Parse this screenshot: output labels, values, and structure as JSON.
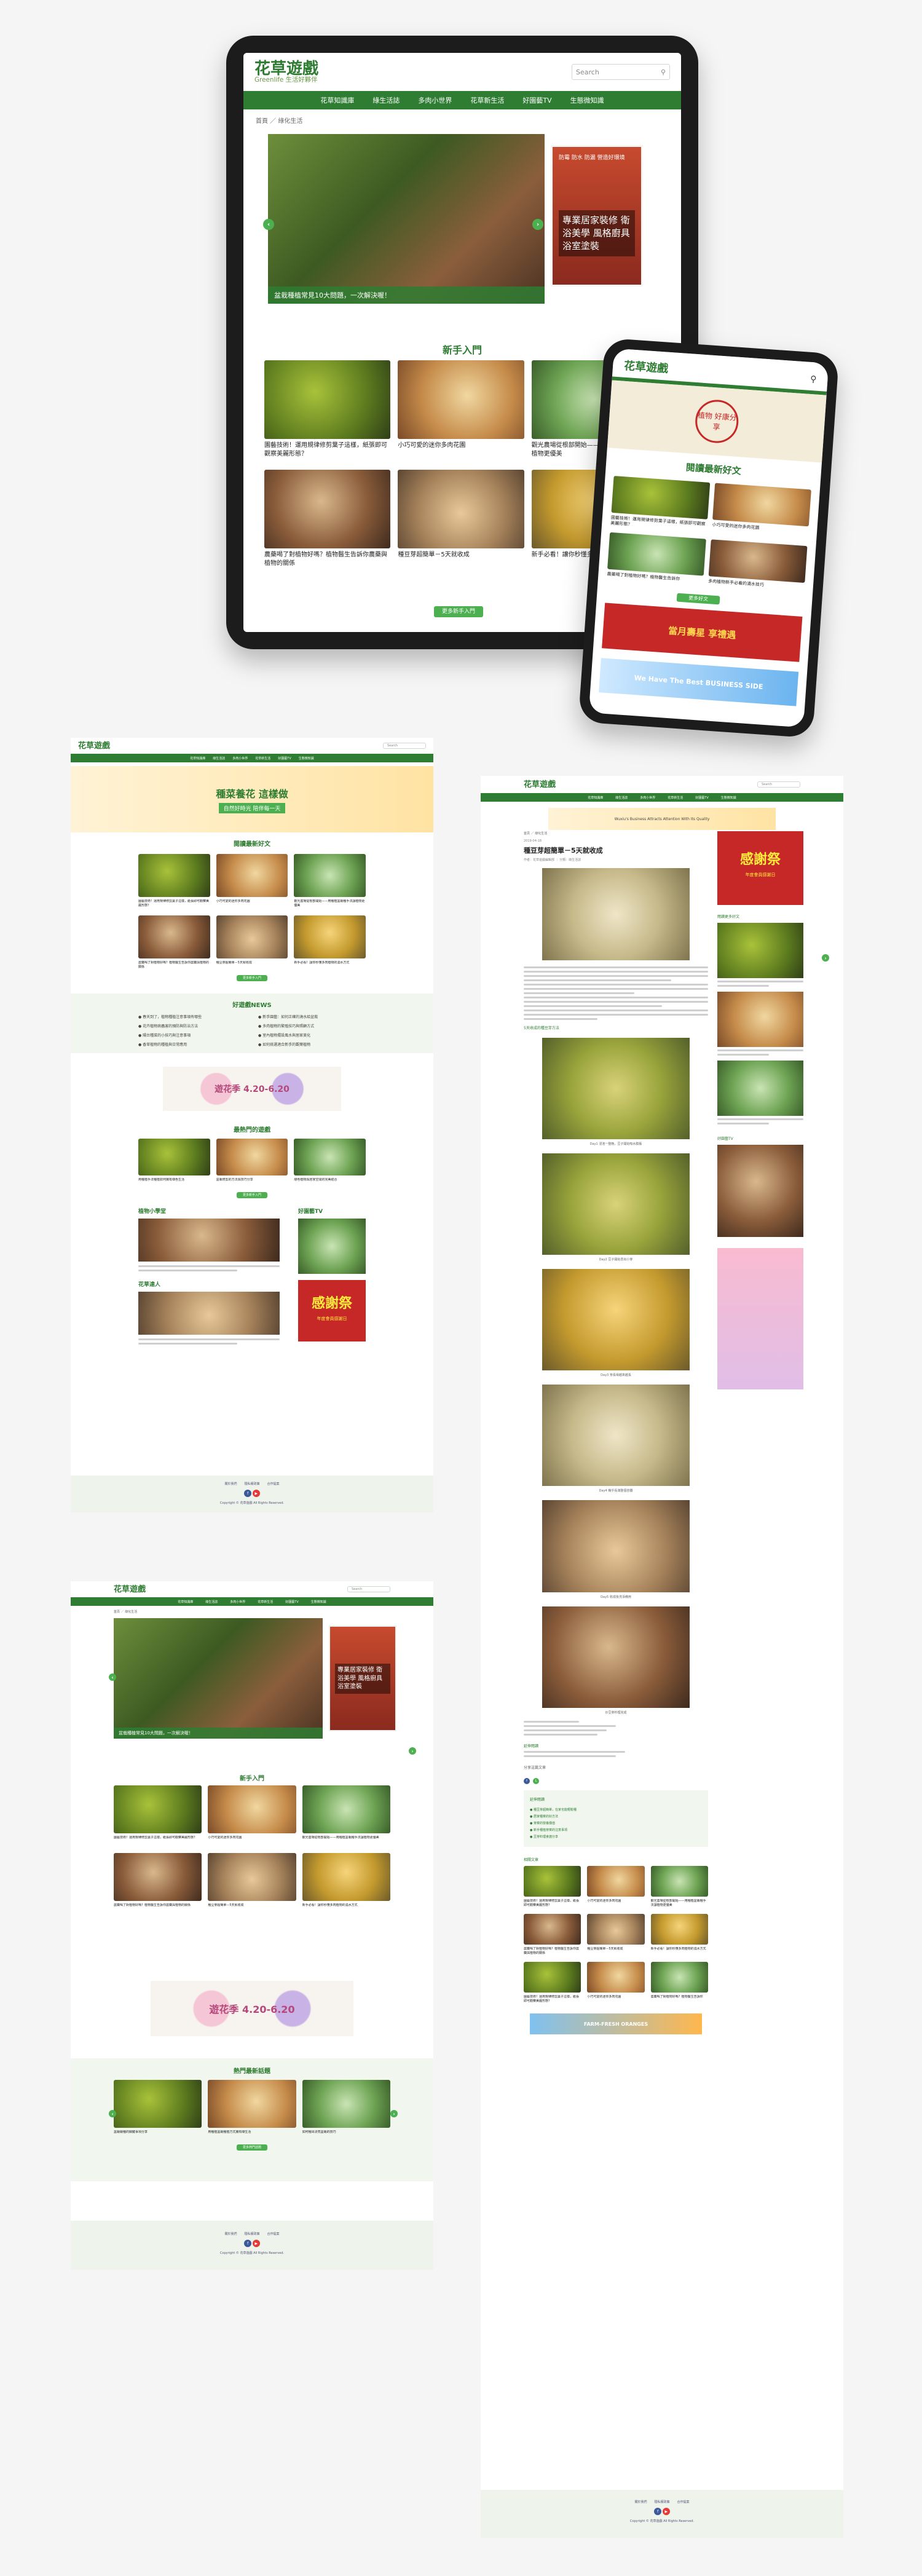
{
  "brand": {
    "name": "花草遊戲",
    "tagline": "Greenlife 生活好夥伴",
    "green": "#2e7d32",
    "accent": "#4caf50"
  },
  "search": {
    "placeholder": "Search"
  },
  "nav": [
    "花草知識庫",
    "綠生活誌",
    "多肉小世界",
    "花草新生活",
    "好園藝TV",
    "生態微知識"
  ],
  "breadcrumb": {
    "home": "首頁",
    "current": "綠化生活"
  },
  "hero": {
    "caption": "盆栽種植常見10大問題，一次解決喔！",
    "side_ad": "專業居家裝修 衛浴美學 風格廚具 浴室塗裝",
    "side_ad_top": "防霉 防水 防漏 營造好環境"
  },
  "section_beginner": "新手入門",
  "beginner_cards": [
    "園藝技術！運用規律修剪葉子這樣，紙張即可觀察美麗形態？",
    "小巧可愛的迷你多肉花園",
    "觀光農場從根部開始——用種植盆栽種手法讓植物更優美",
    "農藥喝了對植物好嗎？植物醫生告訴你農藥與植物的關係",
    "種豆芽超簡單－5天就收成",
    "新手必看！讓你秒懂多肉植物的澆水方式"
  ],
  "more_label": "更多新手入門",
  "phone": {
    "promo_title": "植物 好康分享",
    "section": "閱讀最新好文",
    "cards": [
      "園藝技術！運用規律修剪葉子這樣，紙張即可觀察美麗形態？",
      "小巧可愛的迷你多肉花園",
      "農藥喝了對植物好嗎？植物醫生告訴你",
      "多肉植物新手必看的澆水技巧"
    ],
    "more": "更多好文",
    "ad_red": "當月壽星 享禮遇",
    "ad_blue": "We Have The Best BUSINESS SIDE"
  },
  "left_top": {
    "banner_title": "種菜養花 這樣做",
    "banner_sub": "自然好時光 陪伴每一天",
    "section_latest": "閱讀最新好文",
    "news_title": "好遊戲NEWS",
    "news_items": [
      "春天到了，植物種植注意事項有哪些",
      "新手園藝：如何正確的澆水給盆栽",
      "花卉植物病蟲害的預防與防治方法",
      "多肉植物的繁殖技巧與照顧方式",
      "陽台種菜的小技巧與注意事項",
      "室內植物擺設風水與居家美化",
      "香草植物的種植與日常應用",
      "如何挑選適合新手的觀葉植物"
    ],
    "banner2": "遊花季 4.20-6.20",
    "section_hot": "最熱門的遊戲",
    "hot_cards": [
      "用種植手法種植如何擁有綠色生活",
      "盆栽修剪的方法與技巧分享",
      "綠色植物與居家空間的完美結合"
    ],
    "col_left": "植物小學堂",
    "col_right": "好園藝TV",
    "col_left2": "花草達人",
    "ad_thanks": "感謝祭",
    "ad_thanks_sub": "年度會員感謝日"
  },
  "left_bottom": {
    "section": "新手入門",
    "banner": "遊花季 4.20-6.20",
    "section_hot": "熱門最新話題",
    "hot_cards": [
      "盆栽栽種的關鍵事項分享",
      "用種植盆栽種植方式擁有綠生活",
      "如何種出漂亮盆栽的技巧"
    ],
    "more": "更多熱門話題"
  },
  "footer": {
    "links": [
      "關於我們",
      "隱私權政策",
      "合作提案"
    ],
    "copyright": "Copyright © 花草遊戲 All Rights Reserved."
  },
  "article": {
    "date": "2019-04-18",
    "title": "種豆芽超簡單－5天就收成",
    "meta": "作者：花草遊戲編輯部 ｜ 分類：綠生活誌",
    "top_ad": "Wuxiu's Business Attracts Attention With Its Quality",
    "sub1": "5天收成的種豆芽方法",
    "captions": [
      "Day1 浸泡一整晚，豆子開始吸水膨脹",
      "Day2 豆子開始冒出小芽",
      "Day3 芽長得越來越長",
      "Day4 幾乎長滿整個容器",
      "Day5 收成後洗淨備用",
      "炒豆芽料理完成"
    ],
    "tags_title": "延伸閱讀",
    "share_title": "分享這篇文章",
    "related_title": "延伸閱讀",
    "related_list": [
      "種豆芽超簡單，在家也能輕鬆種",
      "居家種菜的好方法",
      "芽菜的營養價值",
      "新手種植芽菜的注意事項",
      "豆芽料理食譜分享"
    ],
    "grid_title": "相關文章",
    "side_hot": "閱讀更多好文",
    "side_tv": "好園藝TV",
    "ad_thanks": "感謝祭",
    "ad_thanks_sub": "年度會員感謝日",
    "bottom_ad": "FARM-FRESH ORANGES"
  }
}
